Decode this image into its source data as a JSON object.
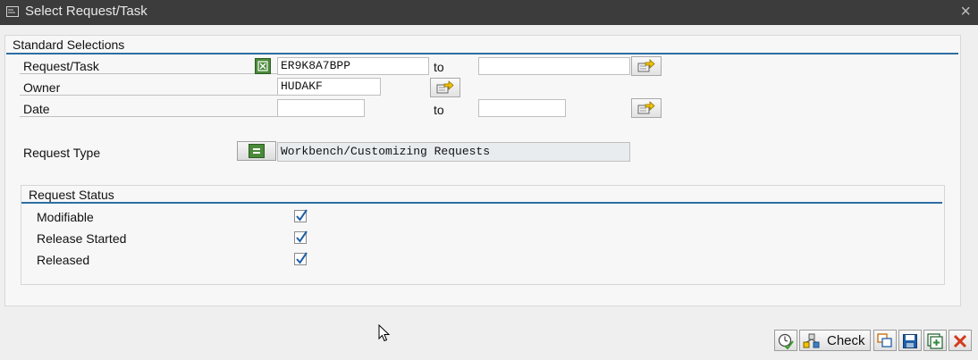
{
  "window": {
    "title": "Select Request/Task",
    "close_label": "×"
  },
  "standard_selections": {
    "title": "Standard Selections",
    "request_task": {
      "label": "Request/Task",
      "from_value": "ER9K8A7BPP",
      "to_label": "to",
      "to_value": ""
    },
    "owner": {
      "label": "Owner",
      "value": "HUDAKF"
    },
    "date": {
      "label": "Date",
      "from_value": "",
      "to_label": "to",
      "to_value": ""
    },
    "request_type": {
      "label": "Request Type",
      "value": "Workbench/Customizing Requests"
    }
  },
  "request_status": {
    "title": "Request Status",
    "items": [
      {
        "label": "Modifiable",
        "checked": true
      },
      {
        "label": "Release Started",
        "checked": true
      },
      {
        "label": "Released",
        "checked": true
      }
    ]
  },
  "toolbar": {
    "check_label": "Check"
  },
  "colors": {
    "title_bar": "#3c3c3c",
    "accent_blue": "#2e6ea3",
    "green": "#4a8a3a",
    "cancel_red": "#d23a1e"
  }
}
